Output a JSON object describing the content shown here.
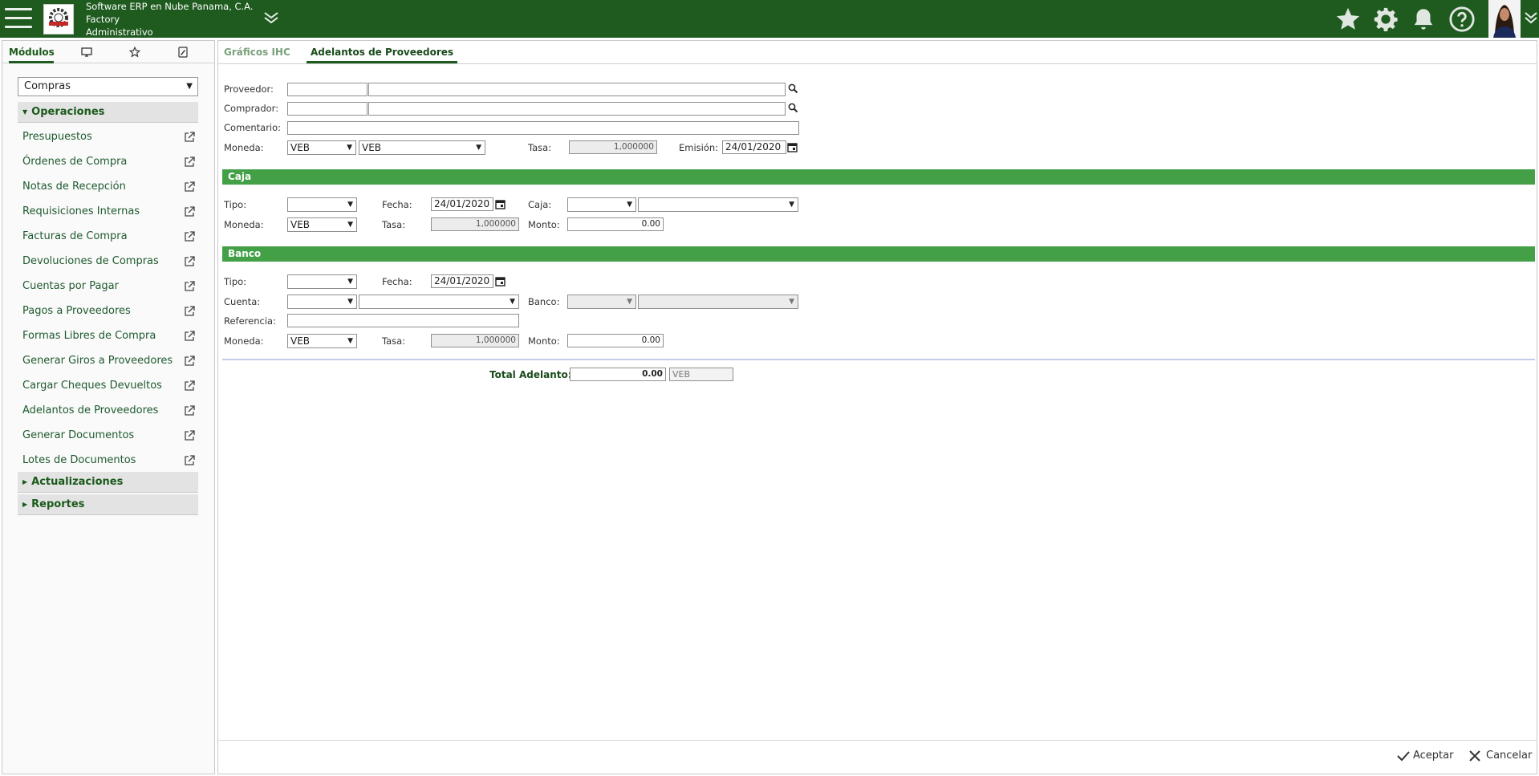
{
  "header": {
    "company_line1": "Software ERP en Nube Panama, C.A.",
    "company_line2": "Factory",
    "company_line3": "Administrativo",
    "bg_color": "#1f5a1f"
  },
  "left_panel": {
    "tabs": [
      {
        "label": "Módulos",
        "icon": ""
      },
      {
        "label": "",
        "icon": "monitor-icon"
      },
      {
        "label": "",
        "icon": "star-icon"
      },
      {
        "label": "",
        "icon": "notepad-icon"
      }
    ],
    "module_select": "Compras",
    "sections": {
      "operaciones": "Operaciones",
      "actualizaciones": "Actualizaciones",
      "reportes": "Reportes"
    },
    "items": [
      "Presupuestos",
      "Órdenes de Compra",
      "Notas de Recepción",
      "Requisiciones Internas",
      "Facturas de Compra",
      "Devoluciones de Compras",
      "Cuentas por Pagar",
      "Pagos a Proveedores",
      "Formas Libres de Compra",
      "Generar Giros a Proveedores",
      "Cargar Cheques Devueltos",
      "Adelantos de Proveedores",
      "Generar Documentos",
      "Lotes de Documentos"
    ]
  },
  "main": {
    "tabs": [
      "Gráficos IHC",
      "Adelantos de Proveedores"
    ],
    "form": {
      "proveedor_label": "Proveedor:",
      "comprador_label": "Comprador:",
      "comentario_label": "Comentario:",
      "moneda_label": "Moneda:",
      "moneda_code": "VEB",
      "moneda_name": "VEB",
      "tasa_label": "Tasa:",
      "tasa_value": "1,000000",
      "emision_label": "Emisión:",
      "emision_value": "24/01/2020"
    },
    "caja": {
      "title": "Caja",
      "tipo_label": "Tipo:",
      "fecha_label": "Fecha:",
      "fecha_value": "24/01/2020",
      "caja_label": "Caja:",
      "moneda_label": "Moneda:",
      "moneda_value": "VEB",
      "tasa_label": "Tasa:",
      "tasa_value": "1,000000",
      "monto_label": "Monto:",
      "monto_value": "0.00"
    },
    "banco": {
      "title": "Banco",
      "tipo_label": "Tipo:",
      "fecha_label": "Fecha:",
      "fecha_value": "24/01/2020",
      "cuenta_label": "Cuenta:",
      "banco_label": "Banco:",
      "referencia_label": "Referencia:",
      "moneda_label": "Moneda:",
      "moneda_value": "VEB",
      "tasa_label": "Tasa:",
      "tasa_value": "1,000000",
      "monto_label": "Monto:",
      "monto_value": "0.00"
    },
    "total": {
      "label": "Total Adelanto:",
      "value": "0.00",
      "currency": "VEB"
    },
    "footer": {
      "accept": "Aceptar",
      "cancel": "Cancelar"
    }
  }
}
